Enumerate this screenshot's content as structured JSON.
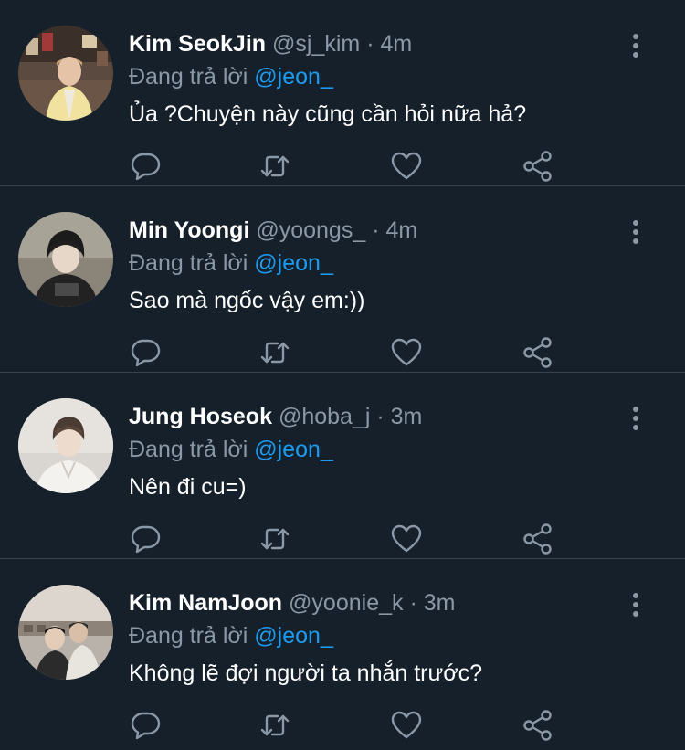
{
  "tweets": [
    {
      "name": "Kim SeokJin",
      "handle": "@sj_kim",
      "separator": "·",
      "time": "4m",
      "reply_prefix": "Đang trả lời",
      "reply_to": "@jeon_",
      "text": "Ủa ?Chuyện này cũng cần hỏi nữa hả?"
    },
    {
      "name": "Min Yoongi",
      "handle": "@yoongs_",
      "separator": "·",
      "time": "4m",
      "reply_prefix": "Đang trả lời",
      "reply_to": "@jeon_",
      "text": "Sao mà ngốc vậy em:))"
    },
    {
      "name": "Jung Hoseok",
      "handle": "@hoba_j",
      "separator": "·",
      "time": "3m",
      "reply_prefix": "Đang trả lời",
      "reply_to": "@jeon_",
      "text": "Nên đi cu=)"
    },
    {
      "name": "Kim NamJoon",
      "handle": "@yoonie_k",
      "separator": "·",
      "time": "3m",
      "reply_prefix": "Đang trả lời",
      "reply_to": "@jeon_",
      "text": "Không lẽ đợi người ta nhắn trước?"
    }
  ],
  "icons": {
    "reply": "reply-icon",
    "retweet": "retweet-icon",
    "like": "heart-icon",
    "share": "share-icon",
    "more": "more-options-icon"
  },
  "colors": {
    "background": "#15202b",
    "divider": "#38444d",
    "primary_text": "#ffffff",
    "secondary_text": "#8b98a5",
    "accent": "#1d9bf0"
  }
}
